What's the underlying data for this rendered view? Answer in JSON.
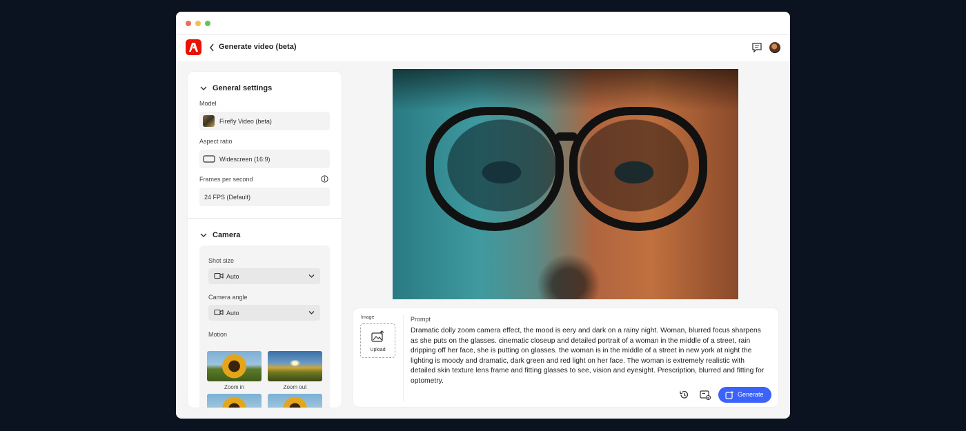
{
  "app": {
    "title": "Generate video (beta)"
  },
  "general_settings": {
    "heading": "General settings",
    "model_label": "Model",
    "model_value": "Firefly Video (beta)",
    "aspect_label": "Aspect ratio",
    "aspect_value": "Widescreen (16:9)",
    "fps_label": "Frames per second",
    "fps_value": "24 FPS (Default)"
  },
  "camera": {
    "heading": "Camera",
    "shot_size_label": "Shot size",
    "shot_size_value": "Auto",
    "angle_label": "Camera angle",
    "angle_value": "Auto",
    "motion_label": "Motion",
    "motions": [
      "Zoom in",
      "Zoom out"
    ]
  },
  "prompt_panel": {
    "image_label": "Image",
    "upload_label": "Upload",
    "prompt_label": "Prompt",
    "prompt_text": "Dramatic dolly zoom camera effect, the mood is eery and dark on a rainy night. Woman, blurred focus sharpens as she puts on the glasses. cinematic closeup and detailed portrait of a woman in the middle of a street, rain dripping off her face, she is putting on glasses. the woman is in the middle of a street in new york at night the lighting is moody and dramatic, dark green and red light on her face. The woman is extremely realistic with detailed skin texture lens frame and fitting glasses to see, vision and eyesight. Prescription, blurred and fitting for optometry.",
    "generate_label": "Generate"
  },
  "colors": {
    "brand": "#eb1000",
    "accent": "#3b63fb",
    "background": "#0b1220"
  },
  "icons": [
    "adobe-logo-icon",
    "chevron-left-icon",
    "chat-icon",
    "chevron-down-icon",
    "info-icon",
    "video-camera-icon",
    "upload-image-icon",
    "history-icon",
    "preset-icon",
    "generate-icon"
  ]
}
